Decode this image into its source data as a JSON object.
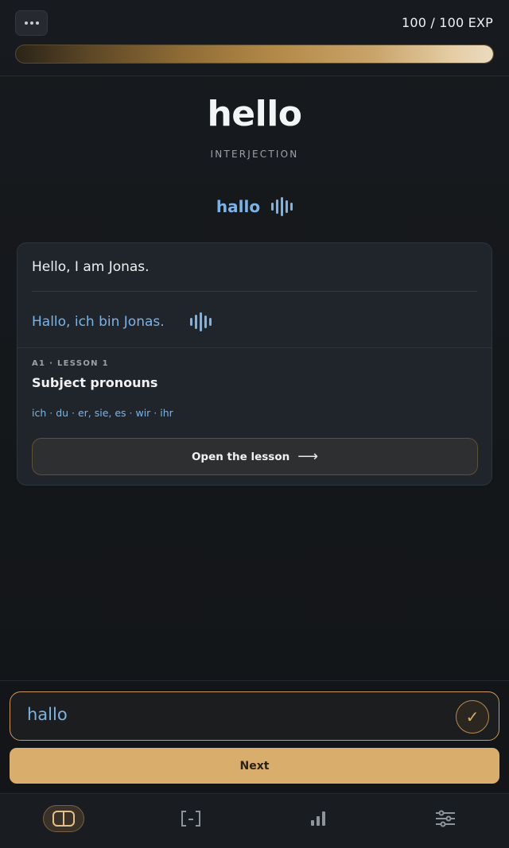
{
  "header": {
    "menu_icon": "more-horizontal-icon",
    "exp_text": "100 / 100 EXP",
    "exp_progress": 1.0
  },
  "word": {
    "text": "hello",
    "part_of_speech": "INTERJECTION",
    "translation": "hallo",
    "translation_audio_icon": "audio-wave-icon"
  },
  "example": {
    "english": "Hello, I am Jonas.",
    "german": "Hallo, ich bin Jonas.",
    "audio_icon": "audio-wave-icon"
  },
  "lesson": {
    "meta": "A1 · LESSON 1",
    "title": "Subject pronouns",
    "terms": "ich · du · er, sie, es · wir · ihr",
    "open_label": "Open the lesson",
    "open_arrow": "⟶"
  },
  "answer": {
    "value": "hallo",
    "check_icon": "check-icon",
    "check_glyph": "✓",
    "next_label": "Next"
  },
  "nav": {
    "items": [
      {
        "icon": "book-icon",
        "active": true
      },
      {
        "icon": "flashcard-icon",
        "active": false
      },
      {
        "icon": "stats-icon",
        "active": false
      },
      {
        "icon": "settings-sliders-icon",
        "active": false
      }
    ]
  },
  "colors": {
    "accent_gold": "#d9ad6b",
    "accent_blue": "#7cb3e6",
    "background": "#15181c"
  }
}
